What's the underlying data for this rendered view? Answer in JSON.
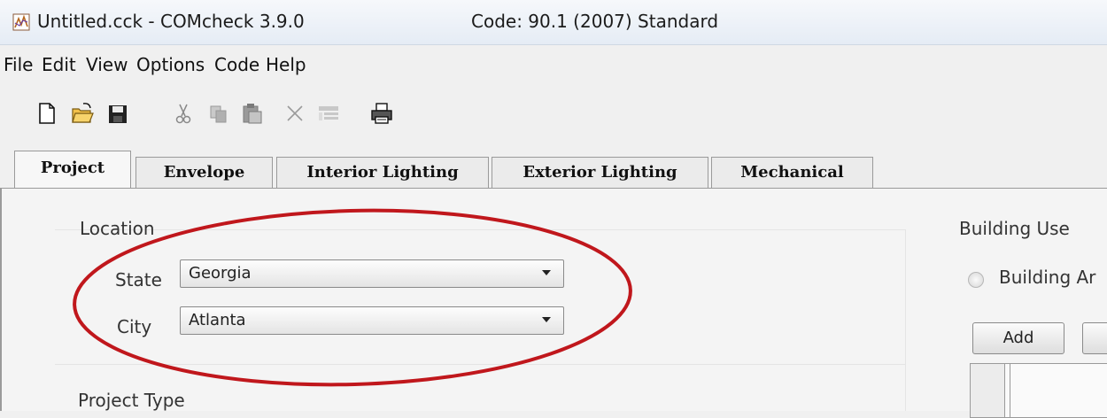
{
  "window": {
    "title": "Untitled.cck - COMcheck 3.9.0",
    "code_label": "Code: 90.1 (2007) Standard"
  },
  "menu": [
    "File",
    "Edit",
    "View",
    "Options",
    "Code",
    "Help"
  ],
  "toolbar": {
    "icons": [
      "new-file-icon",
      "open-folder-icon",
      "save-icon",
      "cut-icon",
      "copy-icon",
      "paste-icon",
      "delete-icon",
      "edit-icon",
      "print-icon"
    ]
  },
  "tabs": [
    {
      "label": "Project",
      "active": true
    },
    {
      "label": "Envelope",
      "active": false
    },
    {
      "label": "Interior Lighting",
      "active": false
    },
    {
      "label": "Exterior Lighting",
      "active": false
    },
    {
      "label": "Mechanical",
      "active": false
    }
  ],
  "location": {
    "heading": "Location",
    "state_label": "State",
    "state_value": "Georgia",
    "city_label": "City",
    "city_value": "Atlanta"
  },
  "building_use": {
    "heading": "Building Use",
    "radio_label": "Building Ar",
    "add_button": "Add"
  },
  "project_type": {
    "heading": "Project Type"
  },
  "colors": {
    "annotation_ellipse": "#c0171c"
  }
}
